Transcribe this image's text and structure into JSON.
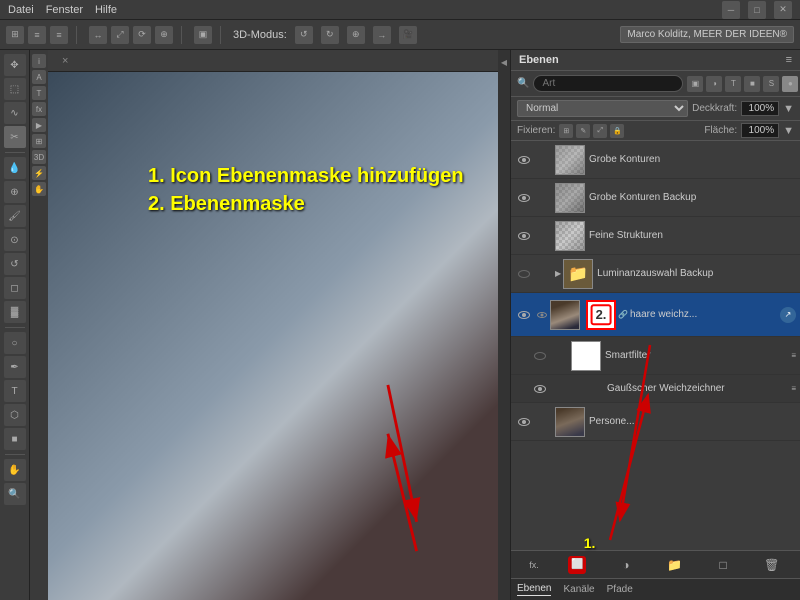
{
  "menu": {
    "items": [
      "Datei",
      "Fenster",
      "Hilfe"
    ]
  },
  "toolbar": {
    "mode_label": "3D-Modus:",
    "workspace": "Marco Kolditz, MEER DER IDEEN®"
  },
  "doc_tab": {
    "title": "",
    "close": "×"
  },
  "canvas": {
    "text_line1": "1. Icon Ebenenmaske hinzufügen",
    "text_line2": "2. Ebenenmaske",
    "num1_label": "1.",
    "num2_label": "2."
  },
  "layers_panel": {
    "title": "Ebenen",
    "search_placeholder": "Art",
    "blend_mode": "Normal",
    "opacity_label": "Deckkraft:",
    "opacity_value": "100%",
    "fixieren_label": "Fixieren:",
    "flaeche_label": "Fläche:",
    "flaeche_value": "100%",
    "layers": [
      {
        "name": "Grobe Konturen",
        "visible": true,
        "type": "normal",
        "has_mask": false
      },
      {
        "name": "Grobe Konturen Backup",
        "visible": true,
        "type": "normal",
        "has_mask": false
      },
      {
        "name": "Feine Strukturen",
        "visible": true,
        "type": "normal",
        "has_mask": false
      },
      {
        "name": "Luminanzauswahl Backup",
        "visible": false,
        "type": "group",
        "has_mask": false
      },
      {
        "name": "haare weichz...",
        "visible": true,
        "type": "smart",
        "has_mask": true,
        "active": true
      },
      {
        "name": "Smartfilter",
        "visible": false,
        "type": "smartfilter",
        "has_mask": true,
        "indent": true
      },
      {
        "name": "Gaußscher Weichzeichner",
        "visible": true,
        "type": "filter",
        "indent": true
      },
      {
        "name": "Persone...",
        "visible": true,
        "type": "normal",
        "has_mask": false
      }
    ],
    "tabs": [
      {
        "label": "Kanäle",
        "active": false
      },
      {
        "label": "Pfade",
        "active": false
      }
    ],
    "bottom_icons": [
      "fx.",
      "mask-add",
      "circle-icon",
      "folder-icon",
      "new-layer-icon",
      "trash-icon"
    ]
  }
}
